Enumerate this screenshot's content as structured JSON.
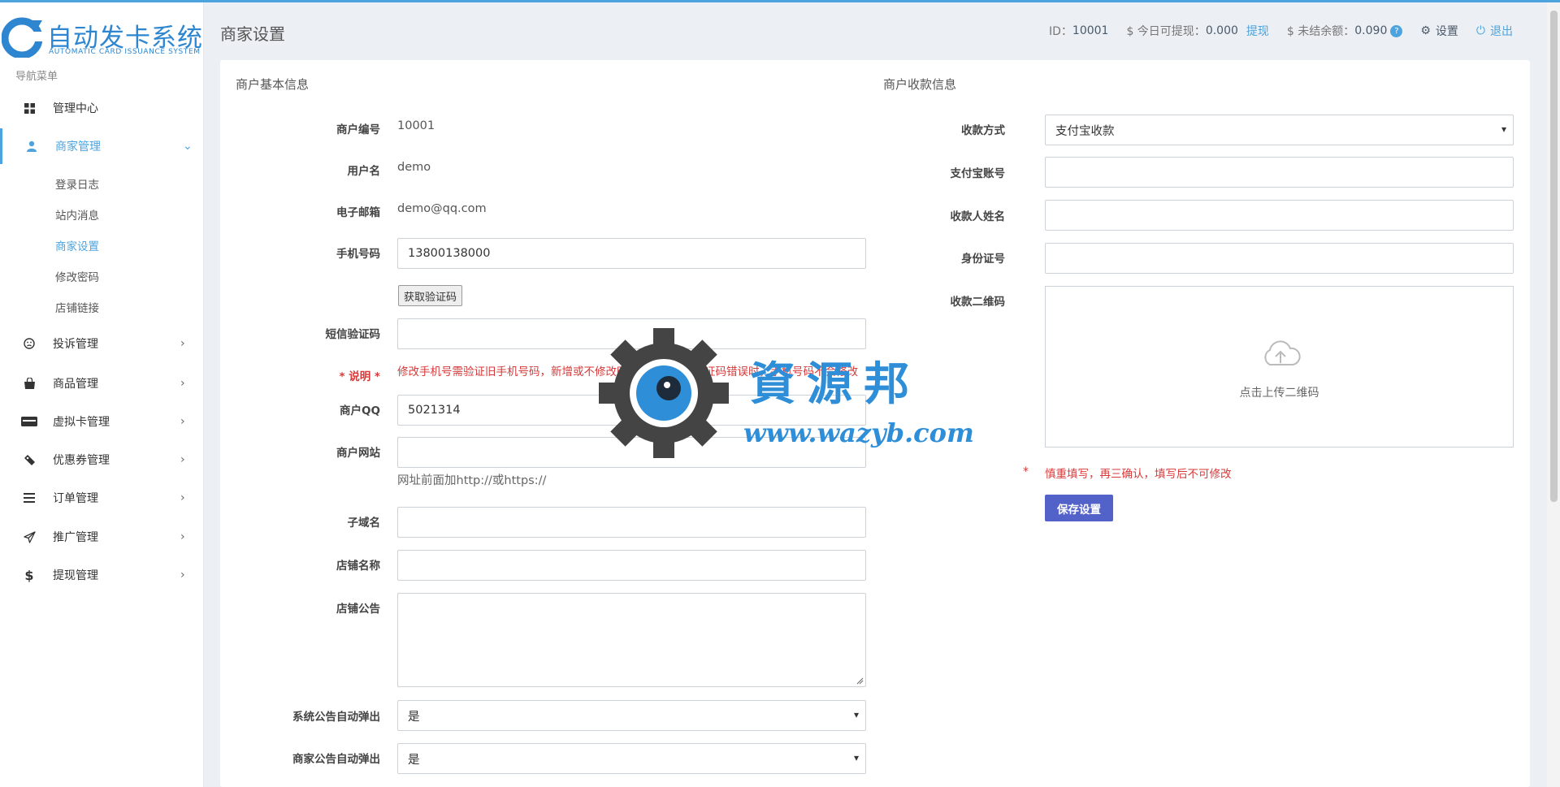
{
  "app": {
    "logo_title": "自动发卡系统",
    "logo_subtitle": "AUTOMATIC CARD ISSUANCE SYSTEM"
  },
  "sidebar": {
    "caption": "导航菜单",
    "items": [
      {
        "label": "管理中心",
        "icon": "dashboard-icon"
      },
      {
        "label": "商家管理",
        "icon": "user-icon",
        "expanded": true,
        "children": [
          {
            "label": "登录日志"
          },
          {
            "label": "站内消息"
          },
          {
            "label": "商家设置",
            "current": true
          },
          {
            "label": "修改密码"
          },
          {
            "label": "店铺链接"
          }
        ]
      },
      {
        "label": "投诉管理",
        "icon": "frown-icon"
      },
      {
        "label": "商品管理",
        "icon": "shopping-bag-icon"
      },
      {
        "label": "虚拟卡管理",
        "icon": "card-icon"
      },
      {
        "label": "优惠券管理",
        "icon": "ticket-icon"
      },
      {
        "label": "订单管理",
        "icon": "list-icon"
      },
      {
        "label": "推广管理",
        "icon": "paper-plane-icon"
      },
      {
        "label": "提现管理",
        "icon": "dollar-icon"
      }
    ]
  },
  "header": {
    "page_title": "商家设置",
    "id_label": "ID：",
    "id_value": "10001",
    "withdrawable_label": "$ 今日可提现：",
    "withdrawable_value": "0.000",
    "withdraw_link": "提现",
    "unsettled_label": "$ 未结余额：",
    "unsettled_value": "0.090",
    "help_icon": "?",
    "settings_label": "设置",
    "logout_label": "退出"
  },
  "basic_info": {
    "section_title": "商户基本信息",
    "merchant_id_label": "商户编号",
    "merchant_id_value": "10001",
    "username_label": "用户名",
    "username_value": "demo",
    "email_label": "电子邮箱",
    "email_value": "demo@qq.com",
    "phone_label": "手机号码",
    "phone_value": "13800138000",
    "get_code_button": "获取验证码",
    "sms_code_label": "短信验证码",
    "sms_code_value": "",
    "note_label": "* 说明 *",
    "note_text": "修改手机号需验证旧手机号码，新增或不修改时此项可不填，验证码错误时，手机号码不会修改",
    "qq_label": "商户QQ",
    "qq_value": "5021314",
    "website_label": "商户网站",
    "website_value": "",
    "website_hint": "网址前面加http://或https://",
    "subdomain_label": "子域名",
    "subdomain_value": "",
    "shop_name_label": "店铺名称",
    "shop_name_value": "",
    "shop_notice_label": "店铺公告",
    "shop_notice_value": "",
    "sys_popup_label": "系统公告自动弹出",
    "sys_popup_value": "是",
    "merchant_popup_label": "商家公告自动弹出",
    "merchant_popup_value": "是"
  },
  "payment_info": {
    "section_title": "商户收款信息",
    "method_label": "收款方式",
    "method_value": "支付宝收款",
    "alipay_account_label": "支付宝账号",
    "alipay_account_value": "",
    "payee_name_label": "收款人姓名",
    "payee_name_value": "",
    "id_number_label": "身份证号",
    "id_number_value": "",
    "qrcode_label": "收款二维码",
    "upload_text": "点击上传二维码",
    "warning_star": "*",
    "warning_text": "慎重填写，再三确认，填写后不可修改",
    "save_button": "保存设置"
  },
  "watermark": {
    "title": "資源邦",
    "url": "www.wazyb.com"
  },
  "colors": {
    "accent": "#4da3dd",
    "save_button": "#5362c8",
    "danger": "#d63a3a",
    "page_bg": "#eceff3"
  }
}
